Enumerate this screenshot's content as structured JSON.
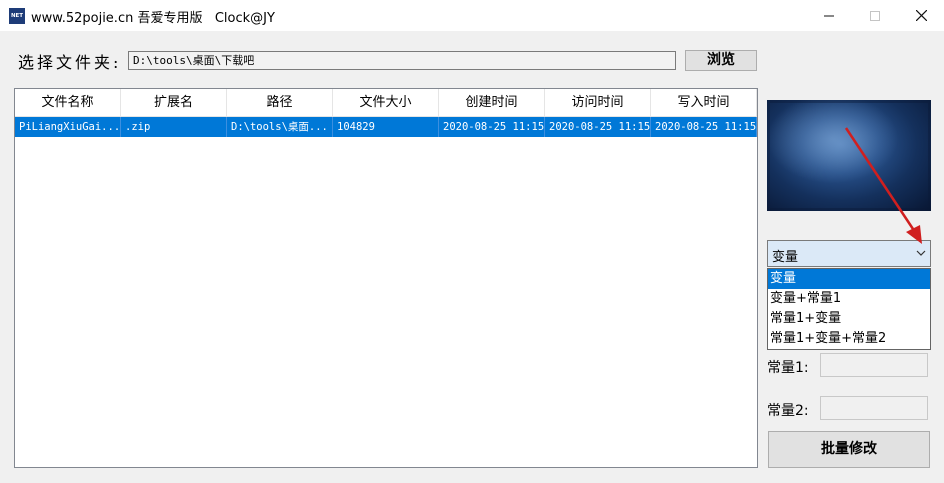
{
  "window": {
    "icon_text": "NET",
    "title": "www.52pojie.cn 吾爱专用版   Clock@JY"
  },
  "folder": {
    "label": "选择文件夹:",
    "path": "D:\\tools\\桌面\\下载吧",
    "browse_label": "浏览"
  },
  "table": {
    "headers": [
      "文件名称",
      "扩展名",
      "路径",
      "文件大小",
      "创建时间",
      "访问时间",
      "写入时间"
    ],
    "rows": [
      [
        "PiLiangXiuGai...",
        ".zip",
        "D:\\tools\\桌面...",
        "104829",
        "2020-08-25 11:15",
        "2020-08-25 11:15",
        "2020-08-25 11:15"
      ]
    ]
  },
  "mode_select": {
    "selected": "变量",
    "options": [
      "变量",
      "变量+常量1",
      "常量1+变量",
      "常量1+变量+常量2"
    ]
  },
  "constants": {
    "const1_label": "常量1:",
    "const2_label": "常量2:"
  },
  "actions": {
    "batch_modify_label": "批量修改"
  },
  "colors": {
    "selection": "#0078d7",
    "annotation_arrow": "#d01f1f"
  }
}
